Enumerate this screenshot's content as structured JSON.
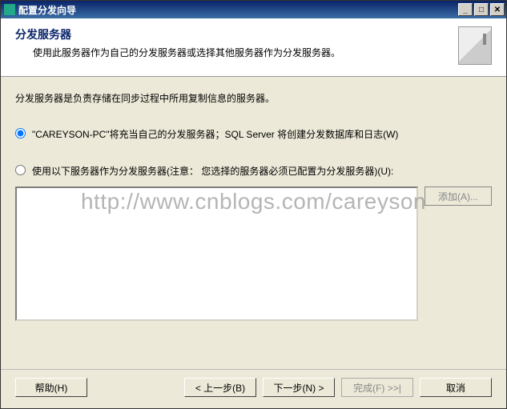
{
  "window": {
    "title": "配置分发向导"
  },
  "header": {
    "title": "分发服务器",
    "subtitle": "使用此服务器作为自己的分发服务器或选择其他服务器作为分发服务器。"
  },
  "main": {
    "description": "分发服务器是负责存储在同步过程中所用复制信息的服务器。",
    "option1": "\"CAREYSON-PC\"将充当自己的分发服务器；SQL Server 将创建分发数据库和日志(W)",
    "option2": "使用以下服务器作为分发服务器(注意： 您选择的服务器必须已配置为分发服务器)(U):",
    "add_button": "添加(A)..."
  },
  "buttons": {
    "help": "帮助(H)",
    "back": "< 上一步(B)",
    "next": "下一步(N) >",
    "finish": "完成(F) >>|",
    "cancel": "取消"
  },
  "watermark": "http://www.cnblogs.com/careyson"
}
